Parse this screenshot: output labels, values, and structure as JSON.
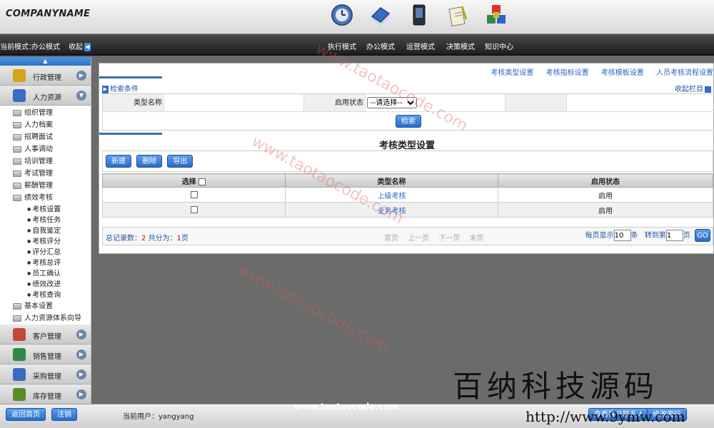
{
  "header": {
    "company": "COMPANYNAME",
    "current_mode_label": "当前模式：",
    "current_mode_value": "办公模式",
    "collapse_label": "收起",
    "nav": [
      {
        "label": "执行模式",
        "icon": "clock-icon"
      },
      {
        "label": "办公模式",
        "icon": "book-icon"
      },
      {
        "label": "运营模式",
        "icon": "phone-icon"
      },
      {
        "label": "决策模式",
        "icon": "document-pen-icon"
      },
      {
        "label": "知识中心",
        "icon": "cubes-icon"
      }
    ]
  },
  "sidebar": {
    "groups_top": [
      {
        "label": "行政管理",
        "icon": "admin-icon",
        "color": "#d8a21c"
      },
      {
        "label": "人力资源",
        "icon": "hr-icon",
        "color": "#3a6cc0"
      }
    ],
    "tree": [
      "组织管理",
      "人力档案",
      "招聘面试",
      "人事调动",
      "培训管理",
      "考试管理",
      "薪酬管理",
      "绩效考核"
    ],
    "subitems": [
      "考核设置",
      "考核任务",
      "自我鉴定",
      "考核评分",
      "评分汇总",
      "考核总评",
      "员工确认",
      "绩效改进",
      "考核查询"
    ],
    "tree_after": [
      "基本设置",
      "人力资源体系向导"
    ],
    "groups_bottom": [
      {
        "label": "客户管理",
        "icon": "customer-icon",
        "color": "#c04a3a"
      },
      {
        "label": "销售管理",
        "icon": "sales-icon",
        "color": "#2f8a4a"
      },
      {
        "label": "采购管理",
        "icon": "purchase-icon",
        "color": "#3a6cc0"
      },
      {
        "label": "库存管理",
        "icon": "inventory-icon",
        "color": "#5a8a2a"
      }
    ]
  },
  "main": {
    "top_links": [
      "考核类型设置",
      "考核指标设置",
      "考核模板设置",
      "人员考核流程设置"
    ],
    "search_title": "检索条件",
    "collapse_panel": "收起栏目",
    "type_name_label": "类型名称",
    "status_label": "启用状态",
    "status_select": "--请选择--",
    "search_button": "检索",
    "title": "考核类型设置",
    "toolbar": {
      "new": "新建",
      "delete": "删除",
      "export": "导出"
    },
    "columns": [
      "选择",
      "类型名称",
      "启用状态"
    ],
    "rows": [
      {
        "name": "上级考核",
        "status": "启用"
      },
      {
        "name": "业务考核",
        "status": "启用"
      }
    ],
    "pager": {
      "total_label": "总记录数：",
      "total": "2",
      "pages_label": "共分为：",
      "pages": "1",
      "pages_unit": "页",
      "first": "首页",
      "prev": "上一页",
      "next": "下一页",
      "last": "末页",
      "per_page_label": "每页显示",
      "per_page": "10",
      "per_page_unit": "条",
      "goto_label": "转到第",
      "goto_value": "1",
      "goto_unit": "页",
      "go": "GO"
    }
  },
  "statusbar": {
    "home": "返回首页",
    "logout": "注销",
    "user_label": "当前用户：",
    "user": "yangyang",
    "contact": "查看客户联系人",
    "password": "修改密码"
  },
  "overlay": {
    "url": "www.taotaocode.com",
    "brand": "百纳科技源码",
    "brand_url": "http://www.9ymw.com"
  }
}
